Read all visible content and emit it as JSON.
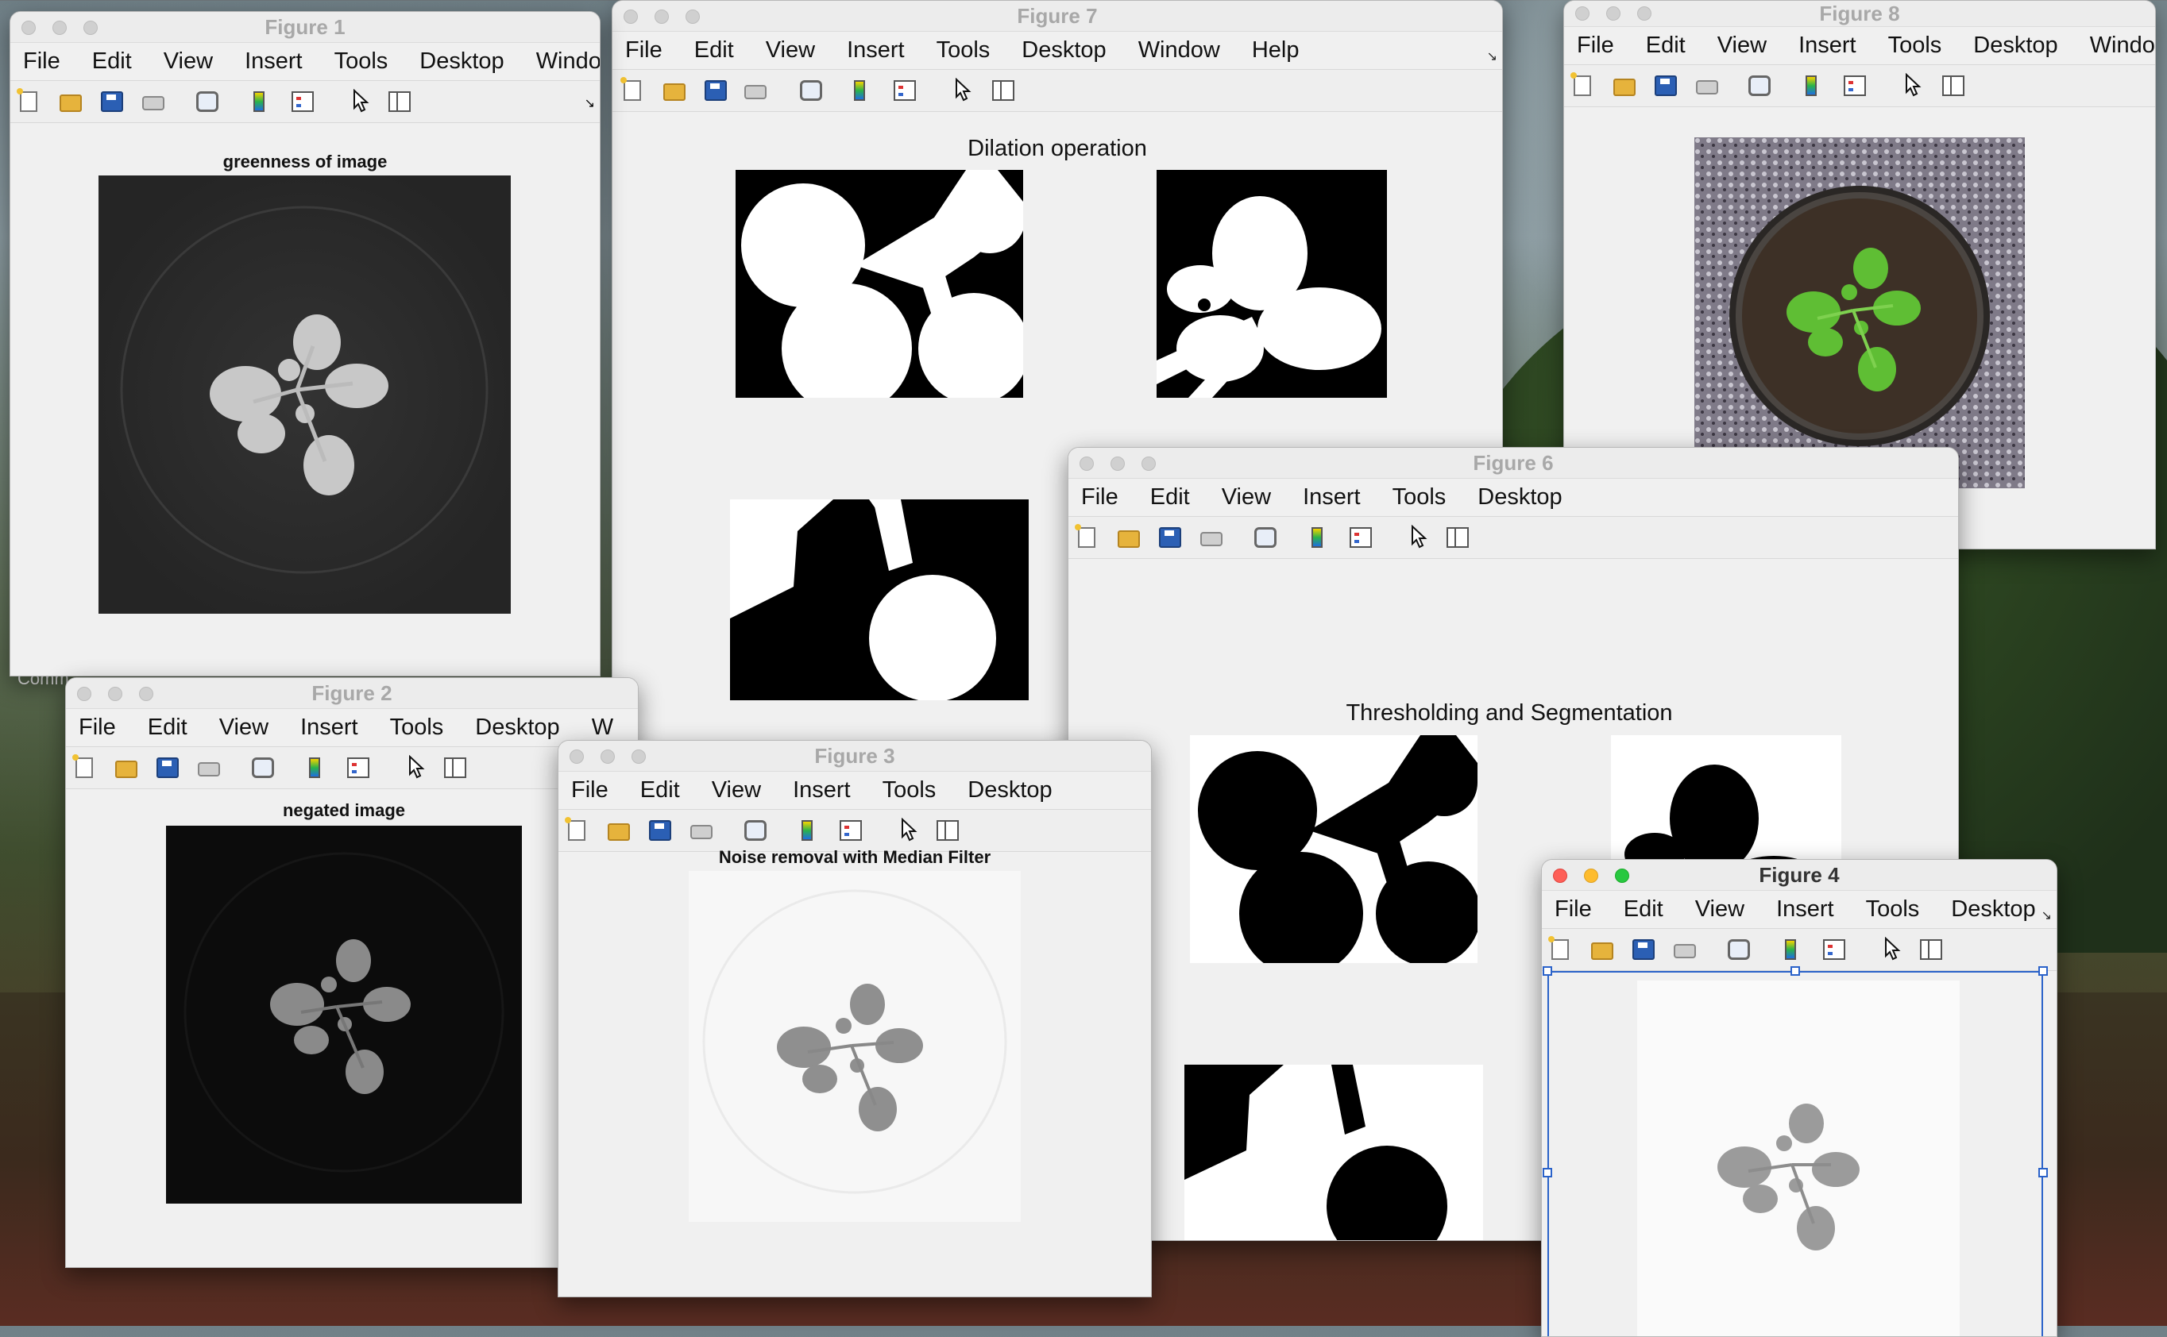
{
  "desktop": {
    "partial_text": "Comm"
  },
  "menus": {
    "full": [
      "File",
      "Edit",
      "View",
      "Insert",
      "Tools",
      "Desktop",
      "Window",
      "Help"
    ],
    "fig1": [
      "File",
      "Edit",
      "View",
      "Insert",
      "Tools",
      "Desktop",
      "Windo"
    ],
    "fig2": [
      "File",
      "Edit",
      "View",
      "Insert",
      "Tools",
      "Desktop",
      "W"
    ],
    "fig3": [
      "File",
      "Edit",
      "View",
      "Insert",
      "Tools",
      "Desktop"
    ],
    "fig6": [
      "File",
      "Edit",
      "View",
      "Insert",
      "Tools",
      "Desktop"
    ],
    "fig8": [
      "File",
      "Edit",
      "View",
      "Insert",
      "Tools",
      "Desktop",
      "Windo"
    ],
    "fig4": [
      "File",
      "Edit",
      "View",
      "Insert",
      "Tools",
      "Desktop"
    ]
  },
  "figures": {
    "fig1": {
      "title": "Figure 1",
      "axis_title": "greenness of image"
    },
    "fig2": {
      "title": "Figure 2",
      "axis_title": "negated image"
    },
    "fig3": {
      "title": "Figure 3",
      "axis_title": "Noise removal with Median Filter"
    },
    "fig4": {
      "title": "Figure 4"
    },
    "fig6": {
      "title": "Figure 6",
      "suptitle": "Thresholding and Segmentation"
    },
    "fig7": {
      "title": "Figure 7",
      "suptitle": "Dilation operation"
    },
    "fig8": {
      "title": "Figure 8"
    }
  },
  "colors": {
    "active_close": "#fe5f57",
    "active_min": "#febc2e",
    "active_max": "#28c840",
    "selection": "#2a62c9",
    "plant_green": "#4caf2e"
  }
}
